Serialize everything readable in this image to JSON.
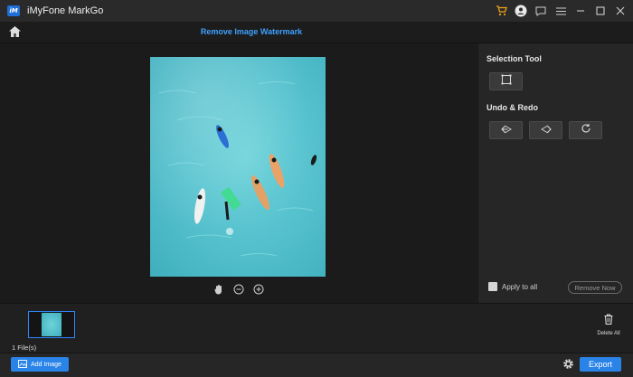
{
  "app": {
    "title": "iMyFone MarkGo",
    "logo_text": "iM"
  },
  "titlebar": {
    "icons": [
      "cart-icon",
      "account-icon",
      "feedback-icon",
      "menu-icon",
      "minimize-icon",
      "maximize-icon",
      "close-icon"
    ]
  },
  "toolbar": {
    "page_title": "Remove Image Watermark"
  },
  "sidebar": {
    "selection_tool_heading": "Selection Tool",
    "undo_redo_heading": "Undo & Redo",
    "apply_to_all_label": "Apply to all",
    "apply_to_all_checked": false,
    "remove_now_label": "Remove Now"
  },
  "filmstrip": {
    "files_count": "1 File(s)",
    "delete_all_label": "Delete All"
  },
  "footer": {
    "add_image_label": "Add Image",
    "export_label": "Export"
  },
  "colors": {
    "accent": "#2a84e8",
    "title_accent": "#3fa2ff",
    "background": "#1e1e1e",
    "panel": "#262626"
  }
}
